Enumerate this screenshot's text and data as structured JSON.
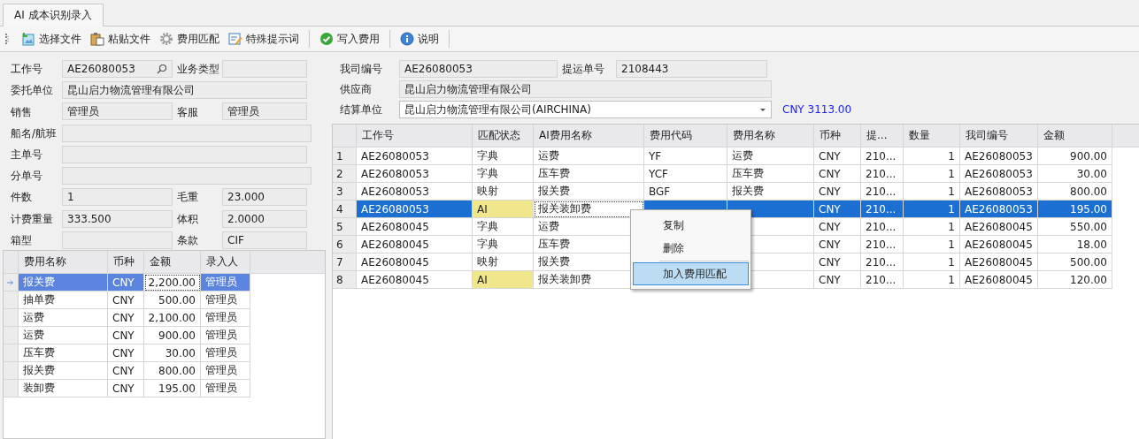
{
  "tab": {
    "label": "AI 成本识别录入",
    "selected": true
  },
  "toolbar": [
    {
      "kind": "file",
      "label": "选择文件",
      "separator_after": false
    },
    {
      "kind": "paste",
      "label": "粘贴文件",
      "separator_after": false
    },
    {
      "kind": "gear",
      "label": "费用匹配",
      "separator_after": false
    },
    {
      "kind": "edit",
      "label": "特殊提示词",
      "separator_after": true
    },
    {
      "kind": "check",
      "label": "写入费用",
      "separator_after": true
    },
    {
      "kind": "info",
      "label": "说明",
      "separator_after": true
    }
  ],
  "job_form": {
    "rows": [
      [
        {
          "label": "工作号",
          "value": "AE26080053",
          "search": true
        },
        {
          "label": "业务类型"
        }
      ],
      [
        {
          "label": "委托单位",
          "value": "昆山启力物流管理有限公司"
        }
      ],
      [
        {
          "label": "销售",
          "value": "管理员"
        },
        {
          "label": "客服",
          "value": "管理员"
        }
      ],
      [
        {
          "label": "船名/航班"
        }
      ],
      [
        {
          "label": "主单号"
        }
      ],
      [
        {
          "label": "分单号"
        }
      ],
      [
        {
          "label": "件数",
          "value": "1"
        },
        {
          "label": "毛重",
          "value": "23.000"
        }
      ],
      [
        {
          "label": "计费重量",
          "value": "333.500"
        },
        {
          "label": "体积",
          "value": "2.0000"
        }
      ],
      [
        {
          "label": "箱型"
        },
        {
          "label": "条款",
          "value": "CIF"
        }
      ]
    ]
  },
  "supplier_form": {
    "rows": [
      [
        {
          "label": "我司编号",
          "value": "AE26080053"
        },
        {
          "label": "提运单号",
          "value": "2108443"
        }
      ],
      [
        {
          "label": "供应商",
          "value": "昆山启力物流管理有限公司"
        }
      ],
      [
        {
          "label": "结算单位",
          "value": "昆山启力物流管理有限公司(AIRCHINA)",
          "dropdown": true
        }
      ]
    ],
    "total": "CNY 3113.00"
  },
  "fee_grid": {
    "columns": [
      {
        "kind": "name",
        "label": "费用名称",
        "focused": false
      },
      {
        "kind": "currency",
        "label": "币种",
        "focused": false
      },
      {
        "kind": "amount",
        "label": "金额",
        "focused": true
      },
      {
        "kind": "user",
        "label": "录入人",
        "focused": false
      }
    ],
    "rows": [
      {
        "selected": true,
        "name": "报关费",
        "currency": "CNY",
        "amount": "2,200.00",
        "user": "管理员"
      },
      {
        "selected": false,
        "name": "抽单费",
        "currency": "CNY",
        "amount": "500.00",
        "user": "管理员"
      },
      {
        "selected": false,
        "name": "运费",
        "currency": "CNY",
        "amount": "2,100.00",
        "user": "管理员"
      },
      {
        "selected": false,
        "name": "运费",
        "currency": "CNY",
        "amount": "900.00",
        "user": "管理员"
      },
      {
        "selected": false,
        "name": "压车费",
        "currency": "CNY",
        "amount": "30.00",
        "user": "管理员"
      },
      {
        "selected": false,
        "name": "报关费",
        "currency": "CNY",
        "amount": "800.00",
        "user": "管理员"
      },
      {
        "selected": false,
        "name": "装卸费",
        "currency": "CNY",
        "amount": "195.00",
        "user": "管理员"
      }
    ]
  },
  "match_grid": {
    "columns": [
      {
        "kind": "job_no",
        "label": "工作号",
        "focused": false
      },
      {
        "kind": "status",
        "label": "匹配状态",
        "focused": false
      },
      {
        "kind": "ai_name",
        "label": "AI费用名称",
        "focused": true
      },
      {
        "kind": "code",
        "label": "费用代码",
        "focused": false
      },
      {
        "kind": "name",
        "label": "费用名称",
        "focused": false
      },
      {
        "kind": "currency",
        "label": "币种",
        "focused": false
      },
      {
        "kind": "bl_no",
        "label": "提...",
        "focused": false
      },
      {
        "kind": "qty",
        "label": "数量",
        "focused": false
      },
      {
        "kind": "our_no",
        "label": "我司编号",
        "focused": false
      },
      {
        "kind": "amount",
        "label": "金额",
        "focused": false
      }
    ],
    "rows": [
      {
        "number": "1",
        "selected": false,
        "highlighted": false,
        "job_no": "AE26080053",
        "status": "字典",
        "ai_name": "运费",
        "code": "YF",
        "name": "运费",
        "currency": "CNY",
        "bl_no": "210...",
        "qty": "1",
        "our_no": "AE26080053",
        "amount": "900.00"
      },
      {
        "number": "2",
        "selected": false,
        "highlighted": false,
        "job_no": "AE26080053",
        "status": "字典",
        "ai_name": "压车费",
        "code": "YCF",
        "name": "压车费",
        "currency": "CNY",
        "bl_no": "210...",
        "qty": "1",
        "our_no": "AE26080053",
        "amount": "30.00"
      },
      {
        "number": "3",
        "selected": false,
        "highlighted": false,
        "job_no": "AE26080053",
        "status": "映射",
        "ai_name": "报关费",
        "code": "BGF",
        "name": "报关费",
        "currency": "CNY",
        "bl_no": "210...",
        "qty": "1",
        "our_no": "AE26080053",
        "amount": "800.00"
      },
      {
        "number": "4",
        "selected": true,
        "highlighted": true,
        "job_no": "AE26080053",
        "status": "AI",
        "ai_name": "报关装卸费",
        "currency": "CNY",
        "bl_no": "210...",
        "qty": "1",
        "our_no": "AE26080053",
        "amount": "195.00"
      },
      {
        "number": "5",
        "selected": false,
        "highlighted": false,
        "job_no": "AE26080045",
        "status": "字典",
        "ai_name": "运费",
        "currency": "CNY",
        "bl_no": "210...",
        "qty": "1",
        "our_no": "AE26080045",
        "amount": "550.00"
      },
      {
        "number": "6",
        "selected": false,
        "highlighted": false,
        "job_no": "AE26080045",
        "status": "字典",
        "ai_name": "压车费",
        "currency": "CNY",
        "bl_no": "210...",
        "qty": "1",
        "our_no": "AE26080045",
        "amount": "18.00"
      },
      {
        "number": "7",
        "selected": false,
        "highlighted": false,
        "job_no": "AE26080045",
        "status": "映射",
        "ai_name": "报关费",
        "currency": "CNY",
        "bl_no": "210...",
        "qty": "1",
        "our_no": "AE26080045",
        "amount": "500.00"
      },
      {
        "number": "8",
        "selected": false,
        "highlighted": true,
        "job_no": "AE26080045",
        "status": "AI",
        "ai_name": "报关装卸费",
        "currency": "CNY",
        "bl_no": "210...",
        "qty": "1",
        "our_no": "AE26080045",
        "amount": "120.00"
      }
    ]
  },
  "context_menu": {
    "items": [
      {
        "label": "复制",
        "selected": false,
        "separator_before": false
      },
      {
        "label": "删除",
        "selected": false,
        "separator_before": false
      },
      {
        "label": "加入费用匹配",
        "selected": true,
        "separator_before": true
      }
    ]
  }
}
